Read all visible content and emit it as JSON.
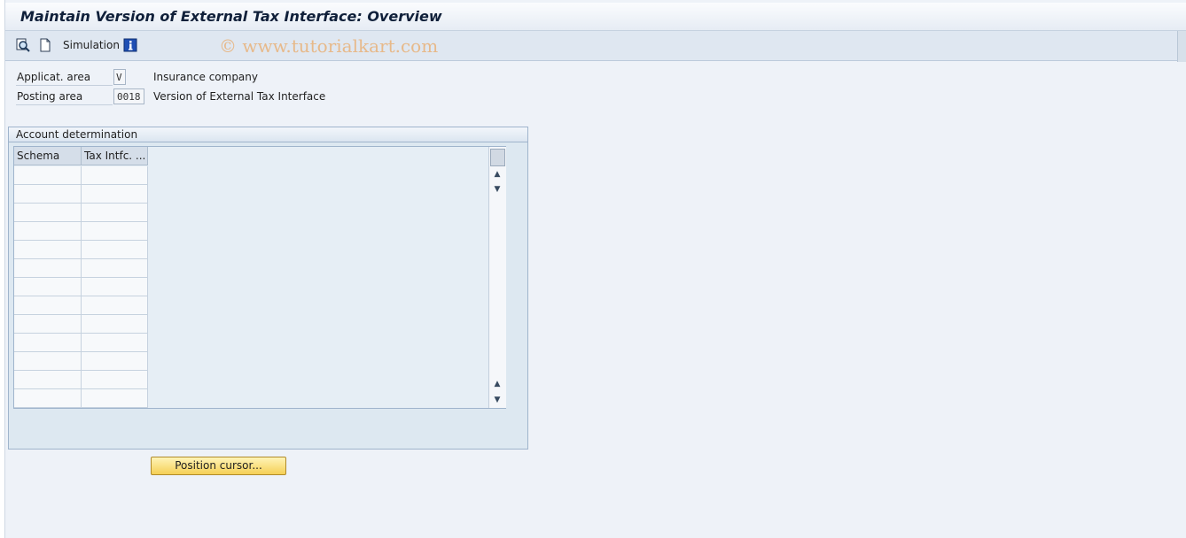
{
  "window": {
    "title": "Maintain Version of External Tax Interface: Overview"
  },
  "toolbar": {
    "icons": [
      "display-icon",
      "new-entries-icon",
      "info-icon"
    ],
    "simulation_label": "Simulation",
    "watermark": "© www.tutorialkart.com"
  },
  "header": {
    "applicat_area": {
      "label": "Applicat. area",
      "value": "V",
      "description": "Insurance company"
    },
    "posting_area": {
      "label": "Posting area",
      "value": "0018",
      "description": "Version of External Tax Interface"
    }
  },
  "account_determination": {
    "title": "Account determination",
    "columns": [
      "Schema",
      "Tax Intfc. ..."
    ],
    "empty_row_count": 13
  },
  "actions": {
    "position_cursor_label": "Position cursor..."
  },
  "colors": {
    "button": "#f5cf55",
    "background": "#eef2f8",
    "header": "#d5dee9"
  }
}
